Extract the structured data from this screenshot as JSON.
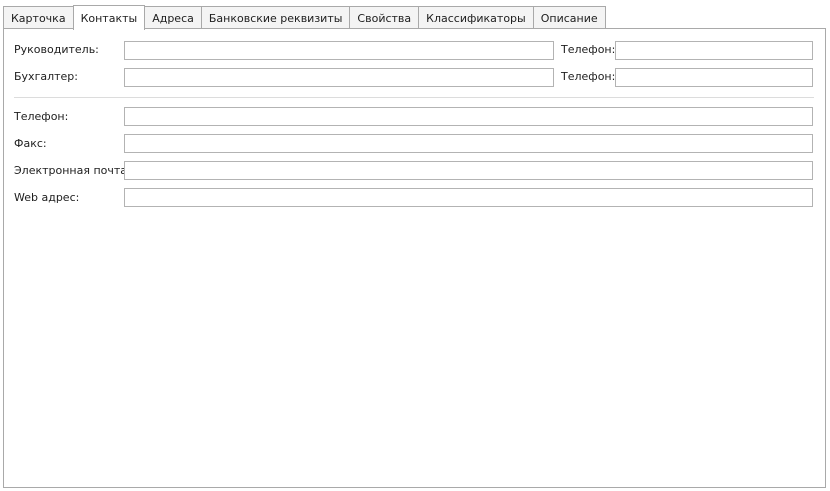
{
  "tabs": [
    {
      "label": "Карточка"
    },
    {
      "label": "Контакты"
    },
    {
      "label": "Адреса"
    },
    {
      "label": "Банковские реквизиты"
    },
    {
      "label": "Свойства"
    },
    {
      "label": "Классификаторы"
    },
    {
      "label": "Описание"
    }
  ],
  "active_tab": "Контакты",
  "form": {
    "director": {
      "label": "Руководитель:",
      "value": "",
      "phone_label": "Телефон:",
      "phone_value": ""
    },
    "accountant": {
      "label": "Бухгалтер:",
      "value": "",
      "phone_label": "Телефон:",
      "phone_value": ""
    },
    "phone": {
      "label": "Телефон:",
      "value": ""
    },
    "fax": {
      "label": "Факс:",
      "value": ""
    },
    "email": {
      "label": "Электронная почта:",
      "value": ""
    },
    "web": {
      "label": "Web адрес:",
      "value": ""
    }
  }
}
